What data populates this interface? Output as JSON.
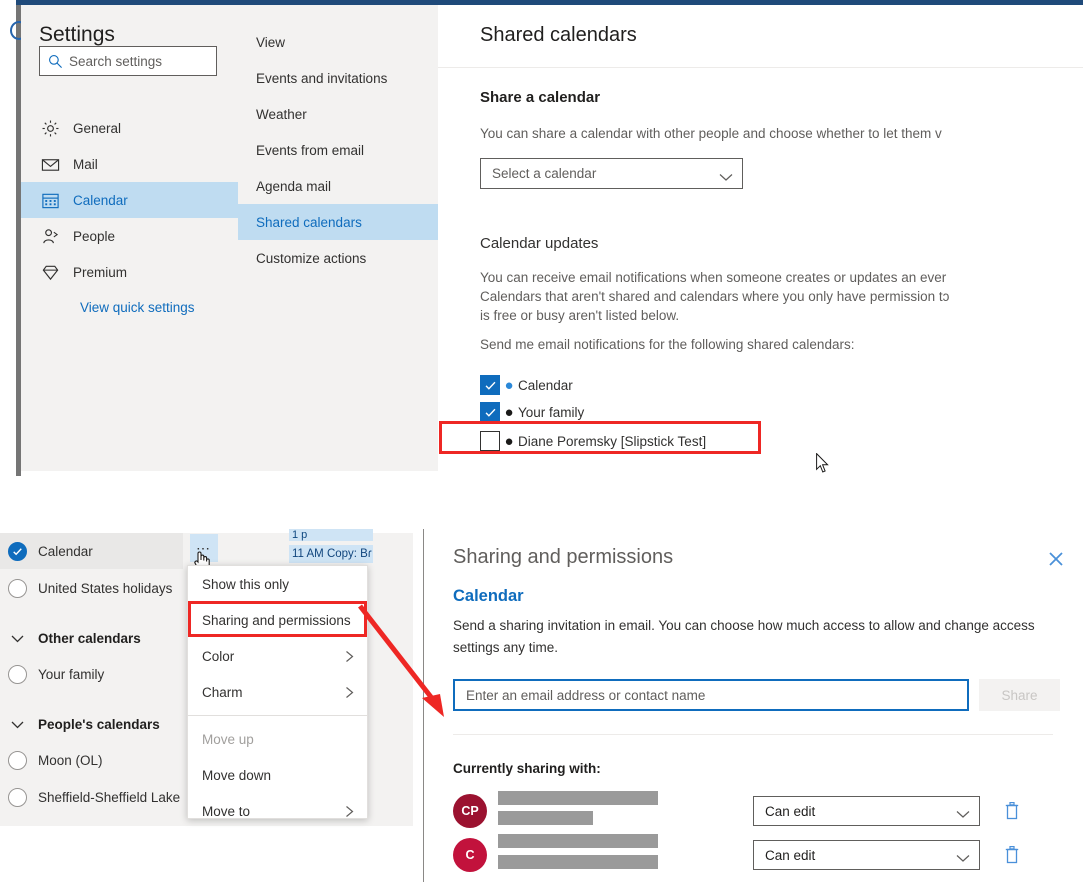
{
  "settings": {
    "title": "Settings",
    "search": {
      "placeholder": "Search settings",
      "icon": "search-icon"
    },
    "nav_items": [
      {
        "label": "General",
        "icon": "gear-icon",
        "selected": false
      },
      {
        "label": "Mail",
        "icon": "envelope-icon",
        "selected": false
      },
      {
        "label": "Calendar",
        "icon": "calendar-icon",
        "selected": true
      },
      {
        "label": "People",
        "icon": "person-icon",
        "selected": false
      },
      {
        "label": "Premium",
        "icon": "diamond-icon",
        "selected": false
      }
    ],
    "quick_settings_link": "View quick settings",
    "sub_items": [
      {
        "label": "View",
        "selected": false
      },
      {
        "label": "Events and invitations",
        "selected": false
      },
      {
        "label": "Weather",
        "selected": false
      },
      {
        "label": "Events from email",
        "selected": false
      },
      {
        "label": "Agenda mail",
        "selected": false
      },
      {
        "label": "Shared calendars",
        "selected": true
      },
      {
        "label": "Customize actions",
        "selected": false
      }
    ]
  },
  "shared_calendars": {
    "heading": "Shared calendars",
    "share_section": {
      "heading": "Share a calendar",
      "description": "You can share a calendar with other people and choose whether to let them v",
      "select_value": "Select a calendar"
    },
    "updates_section": {
      "heading": "Calendar updates",
      "description_line1": "You can receive email notifications when someone creates or updates an ever",
      "description_line2": "Calendars that aren't shared and calendars where you only have permission tɔ",
      "description_line3": "is free or busy aren't listed below.",
      "notify_label": "Send me email notifications for the following shared calendars:",
      "calendars": [
        {
          "label": "Calendar",
          "checked": true,
          "dot_color": "#2b88d8"
        },
        {
          "label": "Your family",
          "checked": true,
          "dot_color": "#1b1a19"
        },
        {
          "label": "Diane Poremsky [Slipstick Test]",
          "checked": false,
          "dot_color": "#1b1a19",
          "highlighted": true
        }
      ]
    }
  },
  "calendar_list": {
    "rows": [
      {
        "type": "calendar",
        "label": "Calendar",
        "checked": true,
        "active": true
      },
      {
        "type": "calendar",
        "label": "United States holidays",
        "checked": false,
        "active": false
      },
      {
        "type": "group",
        "label": "Other calendars"
      },
      {
        "type": "calendar",
        "label": "Your family",
        "checked": false,
        "active": false
      },
      {
        "type": "group",
        "label": "People's calendars"
      },
      {
        "type": "calendar",
        "label": "Moon (OL)",
        "checked": false,
        "active": false
      },
      {
        "type": "calendar",
        "label": "Sheffield-Sheffield Lake",
        "checked": false,
        "active": false
      }
    ],
    "ellipsis_label": "⋯",
    "event_fragments": {
      "top": "1 p",
      "main": "11 AM Copy: Bɾ"
    }
  },
  "context_menu": {
    "items": [
      {
        "label": "Show this only",
        "submenu": false,
        "disabled": false,
        "highlighted": false
      },
      {
        "label": "Sharing and permissions",
        "submenu": false,
        "disabled": false,
        "highlighted": true
      },
      {
        "label": "Color",
        "submenu": true,
        "disabled": false,
        "highlighted": false
      },
      {
        "label": "Charm",
        "submenu": true,
        "disabled": false,
        "highlighted": false
      },
      {
        "separator": true
      },
      {
        "label": "Move up",
        "submenu": false,
        "disabled": true,
        "highlighted": false
      },
      {
        "label": "Move down",
        "submenu": false,
        "disabled": false,
        "highlighted": false
      },
      {
        "label": "Move to",
        "submenu": true,
        "disabled": false,
        "highlighted": false
      }
    ]
  },
  "sharing_panel": {
    "title": "Sharing and permissions",
    "close_icon": "close-icon",
    "calendar_name": "Calendar",
    "description": "Send a sharing invitation in email. You can choose how much access to allow and change access settings any time.",
    "email_placeholder": "Enter an email address or contact name",
    "share_button": "Share",
    "currently_sharing_label": "Currently sharing with:",
    "people": [
      {
        "initials": "CP",
        "avatar_color": "#9b1230",
        "permission": "Can edit",
        "delete_icon": "trash-icon"
      },
      {
        "initials": "C",
        "avatar_color": "#c2123c",
        "permission": "Can edit",
        "delete_icon": "trash-icon"
      }
    ]
  },
  "annotations": {
    "highlight_color": "#ee2724",
    "arrow_color": "#ee2724"
  }
}
